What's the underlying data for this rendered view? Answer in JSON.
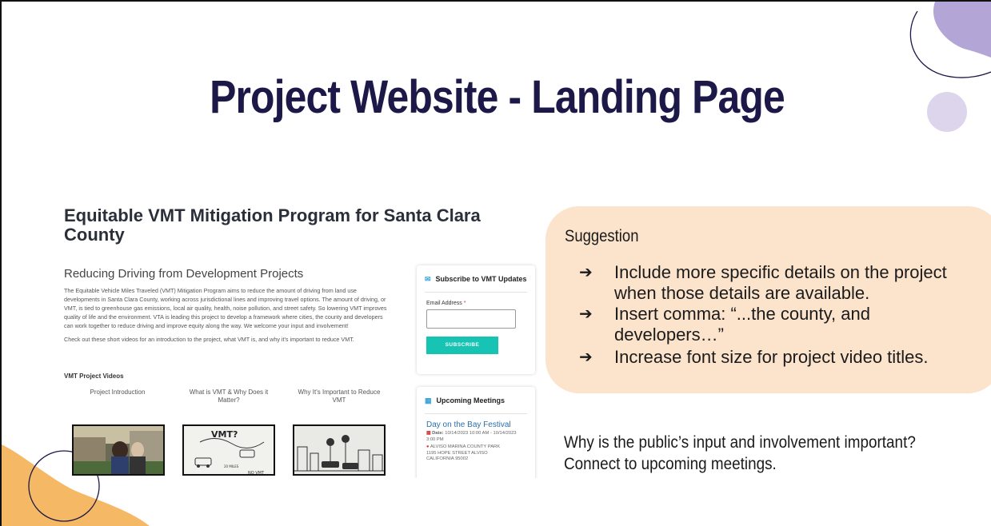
{
  "slide": {
    "title": "Project Website - Landing Page"
  },
  "website": {
    "heading": "Equitable VMT Mitigation Program for Santa Clara County",
    "subheading": "Reducing Driving from Development Projects",
    "paragraph1": "The Equitable Vehicle Miles Traveled (VMT) Mitigation Program aims to reduce the amount of driving from land use developments in Santa Clara County, working across jurisdictional lines and improving travel options. The amount of driving, or VMT, is tied to greenhouse gas emissions, local air quality, health, noise pollution, and street safety. So lowering VMT improves quality of life and the environment. VTA is leading this project to develop a framework where cities, the county and developers can work together to reduce driving and improve equity along the way.  We welcome your input and involvement!",
    "paragraph2": "Check out these short videos for an introduction to the project, what VMT is, and why it's important to reduce VMT.",
    "videos_heading": "VMT Project Videos",
    "videos": [
      {
        "title": "Project Introduction"
      },
      {
        "title": "What is VMT & Why Does it Matter?"
      },
      {
        "title": "Why It's Important to Reduce VMT"
      }
    ],
    "subscribe": {
      "icon": "envelope-icon",
      "heading": "Subscribe to VMT Updates",
      "email_label": "Email Address",
      "required_marker": "*",
      "email_value": "",
      "button_label": "SUBSCRIBE",
      "button_color": "#17c3b2"
    },
    "meetings": {
      "icon": "calendar-icon",
      "heading": "Upcoming Meetings",
      "event_title": "Day on the Bay Festival",
      "date_label": "Date:",
      "date_text": "10/14/2023 10:00 AM - 10/14/2023 3:00 PM",
      "location_line1": "ALVISO MARINA COUNTY PARK",
      "location_line2": "1195 HOPE STREET ALVISO",
      "location_line3": "CALIFORNIA 95002"
    }
  },
  "suggestion": {
    "heading": "Suggestion",
    "items": [
      {
        "text": "Include more specific details on the project when those details are available."
      },
      {
        "text": "Insert comma: “...the county, and developers…”"
      },
      {
        "text": "Increase font size for project video titles."
      }
    ],
    "arrow_glyph": "➔",
    "panel_color": "#fbe3cc"
  },
  "question": {
    "line1": "Why is the public’s input and involvement important?",
    "line2": "Connect to upcoming meetings."
  },
  "colors": {
    "title": "#1c1848",
    "deco_purple": "#b3a6d6",
    "deco_orange": "#f5b865"
  }
}
